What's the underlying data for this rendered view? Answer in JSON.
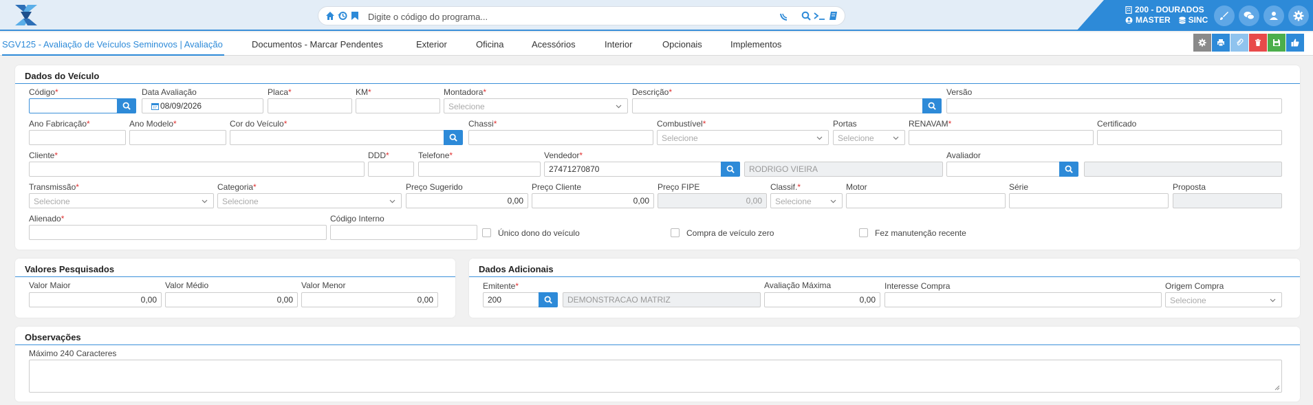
{
  "header": {
    "search_placeholder": "Digite o código do programa...",
    "branch": "200 - DOURADOS",
    "user": "MASTER",
    "sync": "SINC"
  },
  "tabs": [
    {
      "label": "SGV125 - Avaliação de Veículos Seminovos | Avaliação"
    },
    {
      "label": "Documentos - Marcar Pendentes"
    },
    {
      "label": "Exterior"
    },
    {
      "label": "Oficina"
    },
    {
      "label": "Acessórios"
    },
    {
      "label": "Interior"
    },
    {
      "label": "Opcionais"
    },
    {
      "label": "Implementos"
    }
  ],
  "colors": {
    "accent": "#2d8ad8",
    "required": "#e03030",
    "delete": "#e84a4a",
    "save": "#4cae4c",
    "settings": "#8a8a8a"
  },
  "dados_veiculo": {
    "title": "Dados do Veículo",
    "codigo": "Código",
    "data_avaliacao": "Data Avaliação",
    "data_avaliacao_value": "08/09/2026",
    "placa": "Placa",
    "km": "KM",
    "montadora": "Montadora",
    "descricao": "Descrição",
    "versao": "Versão",
    "ano_fabricacao": "Ano Fabricação",
    "ano_modelo": "Ano Modelo",
    "cor_veiculo": "Cor do Veículo",
    "chassi": "Chassi",
    "combustivel": "Combustível",
    "portas": "Portas",
    "renavam": "RENAVAM",
    "certificado": "Certificado",
    "cliente": "Cliente",
    "ddd": "DDD",
    "telefone": "Telefone",
    "vendedor": "Vendedor",
    "vendedor_value": "27471270870",
    "vendedor_nome": "RODRIGO VIEIRA",
    "avaliador": "Avaliador",
    "transmissao": "Transmissão",
    "categoria": "Categoria",
    "preco_sugerido": "Preço Sugerido",
    "preco_sugerido_value": "0,00",
    "preco_cliente": "Preço Cliente",
    "preco_cliente_value": "0,00",
    "preco_fipe": "Preço FIPE",
    "preco_fipe_value": "0,00",
    "classif": "Classif.",
    "motor": "Motor",
    "serie": "Série",
    "proposta": "Proposta",
    "alienado": "Alienado",
    "codigo_interno": "Código Interno",
    "unico_dono": "Único dono do veículo",
    "compra_zero": "Compra de veículo zero",
    "manutencao": "Fez manutenção recente",
    "selecione": "Selecione",
    "req": "*"
  },
  "valores": {
    "title": "Valores Pesquisados",
    "maior": "Valor Maior",
    "maior_value": "0,00",
    "medio": "Valor Médio",
    "medio_value": "0,00",
    "menor": "Valor Menor",
    "menor_value": "0,00"
  },
  "adicionais": {
    "title": "Dados Adicionais",
    "emitente": "Emitente",
    "emitente_value": "200",
    "emitente_nome": "DEMONSTRACAO MATRIZ",
    "avaliacao_maxima": "Avaliação Máxima",
    "avaliacao_maxima_value": "0,00",
    "interesse_compra": "Interesse Compra",
    "origem_compra": "Origem Compra",
    "selecione": "Selecione"
  },
  "observacoes": {
    "title": "Observações",
    "hint": "Máximo 240 Caracteres"
  }
}
